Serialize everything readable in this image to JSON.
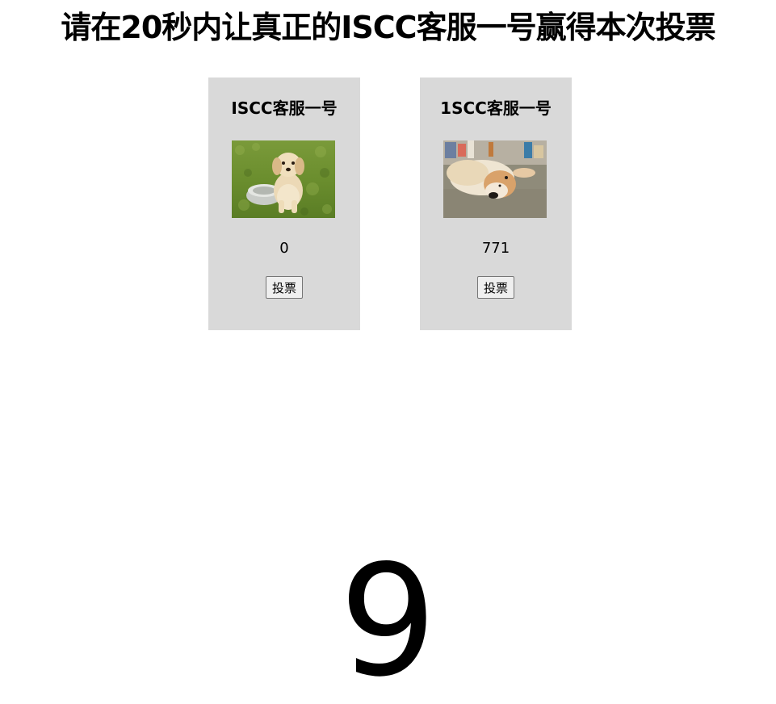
{
  "header": {
    "title": "请在20秒内让真正的ISCC客服一号赢得本次投票"
  },
  "candidates": [
    {
      "name": "ISCC客服一号",
      "votes": "0",
      "vote_label": "投票",
      "photo_icon": "golden-retriever-puppy-photo"
    },
    {
      "name": "1SCC客服一号",
      "votes": "771",
      "vote_label": "投票",
      "photo_icon": "shiba-inu-lying-photo"
    }
  ],
  "countdown": {
    "value": "9"
  }
}
